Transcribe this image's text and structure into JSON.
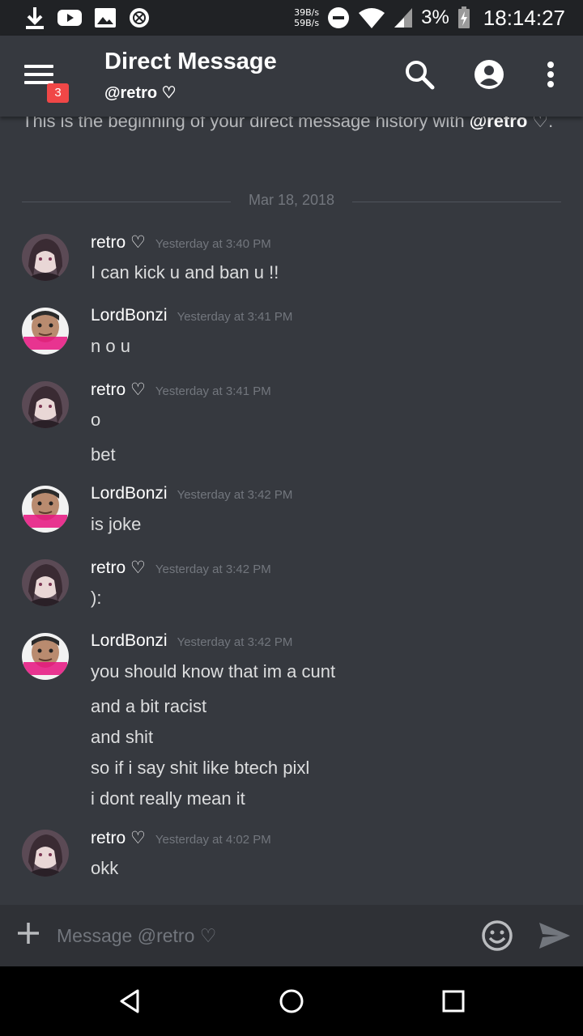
{
  "status_bar": {
    "net_up": "39B/s",
    "net_down": "59B/s",
    "battery": "3%",
    "time": "18:14:27",
    "icons": [
      "download-icon",
      "youtube-icon",
      "gallery-icon",
      "app-icon",
      "dnd-icon",
      "wifi-icon",
      "signal-icon",
      "battery-charging-icon"
    ]
  },
  "header": {
    "title": "Direct Message",
    "subtitle": "@retro ♡",
    "badge": "3",
    "icons": [
      "menu-icon",
      "search-icon",
      "profile-icon",
      "more-vertical-icon"
    ]
  },
  "chat": {
    "intro_prefix": "This is the beginning of your direct message history with ",
    "intro_user": "@retro",
    "intro_suffix": "♡.",
    "date_divider": "Mar 18, 2018",
    "messages": [
      {
        "author": "retro ♡",
        "timestamp": "Yesterday at 3:40 PM",
        "lines": [
          "I can kick u and ban u !!"
        ]
      },
      {
        "author": "LordBonzi",
        "timestamp": "Yesterday at 3:41 PM",
        "lines": [
          "n o u"
        ]
      },
      {
        "author": "retro ♡",
        "timestamp": "Yesterday at 3:41 PM",
        "lines": [
          "o",
          "bet"
        ]
      },
      {
        "author": "LordBonzi",
        "timestamp": "Yesterday at 3:42 PM",
        "lines": [
          "is joke"
        ]
      },
      {
        "author": "retro ♡",
        "timestamp": "Yesterday at 3:42 PM",
        "lines": [
          "):"
        ]
      },
      {
        "author": "LordBonzi",
        "timestamp": "Yesterday at 3:42 PM",
        "lines": [
          "you should know that im a cunt",
          "and a bit racist",
          "and shit",
          "so if i say shit like btech pixl",
          "i dont really mean it"
        ]
      },
      {
        "author": "retro ♡",
        "timestamp": "Yesterday at 4:02 PM",
        "lines": [
          "okk"
        ]
      }
    ]
  },
  "input": {
    "placeholder": "Message @retro ♡"
  },
  "nav": {
    "icons": [
      "back-icon",
      "home-icon",
      "recents-icon"
    ]
  },
  "colors": {
    "background": "#36393f",
    "header_bar": "#202225",
    "input_bar": "#2f3136",
    "badge": "#f04747",
    "timestamp": "#72767d"
  }
}
